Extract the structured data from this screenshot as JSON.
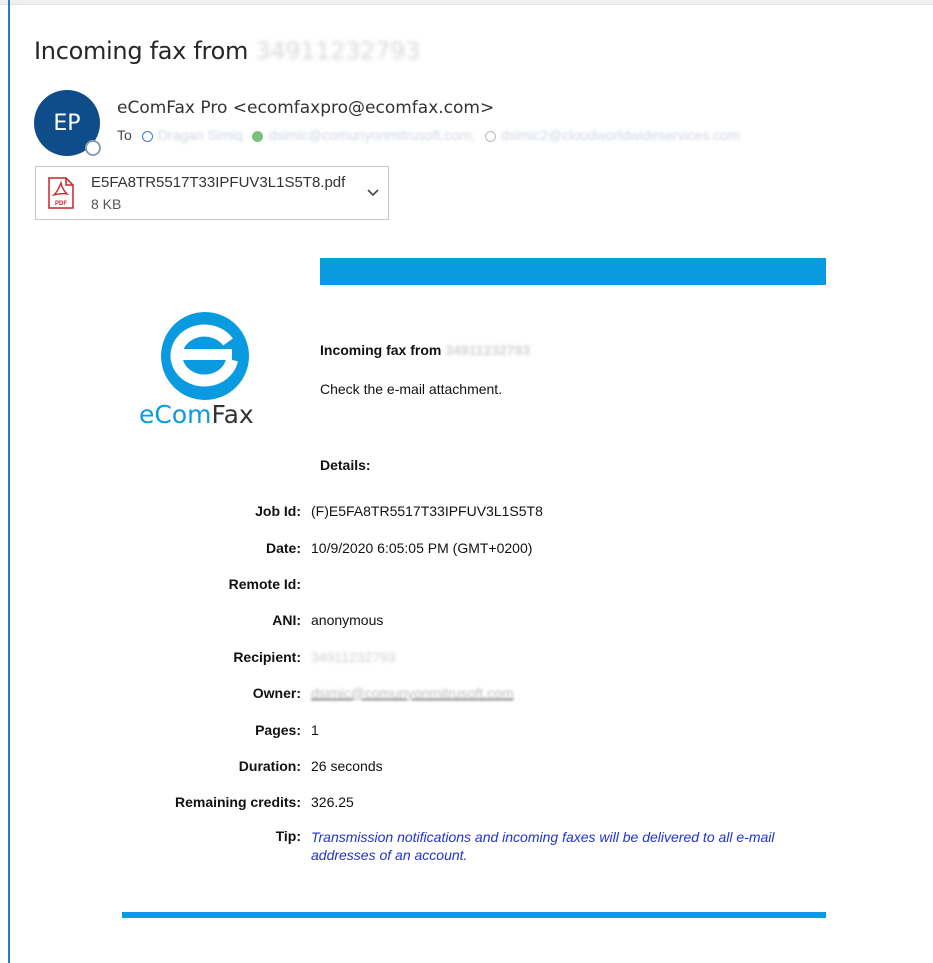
{
  "email": {
    "subject_prefix": "Incoming fax from",
    "subject_number": "34911232793",
    "avatar_initials": "EP",
    "sender": "eComFax Pro <ecomfaxpro@ecomfax.com>",
    "to_label": "To",
    "recipients": [
      {
        "name": "Dragan Simiq"
      },
      {
        "name": "dsimic@comunyonmitrusoft.com;"
      },
      {
        "name": "dsimic2@cloudworldwideservices.com"
      }
    ],
    "attachment": {
      "filename": "E5FA8TR5517T33IPFUV3L1S5T8.pdf",
      "size": "8 KB",
      "icon": "pdf-icon",
      "badge": "PDF"
    }
  },
  "fax": {
    "brand_logo": {
      "prefix": "eCom",
      "suffix": "Fax"
    },
    "heading_prefix": "Incoming fax from",
    "heading_number": "34911232793",
    "instruction": "Check the e-mail attachment.",
    "details_title": "Details:",
    "details": [
      {
        "label": "Job Id:",
        "value": "(F)E5FA8TR5517T33IPFUV3L1S5T8"
      },
      {
        "label": "Date:",
        "value": "10/9/2020 6:05:05 PM (GMT+0200)"
      },
      {
        "label": "Remote Id:",
        "value": ""
      },
      {
        "label": "ANI:",
        "value": "anonymous"
      },
      {
        "label": "Recipient:",
        "value": "34911232793"
      },
      {
        "label": "Owner:",
        "value": "dsimic@comunyonmitrusoft.com"
      },
      {
        "label": "Pages:",
        "value": "1"
      },
      {
        "label": "Duration:",
        "value": "26 seconds"
      },
      {
        "label": "Remaining credits:",
        "value": "326.25"
      }
    ],
    "tip_label": "Tip:",
    "tip_text": "Transmission notifications and incoming faxes will be delivered to all e-mail addresses of an account."
  },
  "colors": {
    "accent": "#0a9ae0",
    "avatar": "#0f4c8a",
    "tip": "#1f33d6"
  }
}
